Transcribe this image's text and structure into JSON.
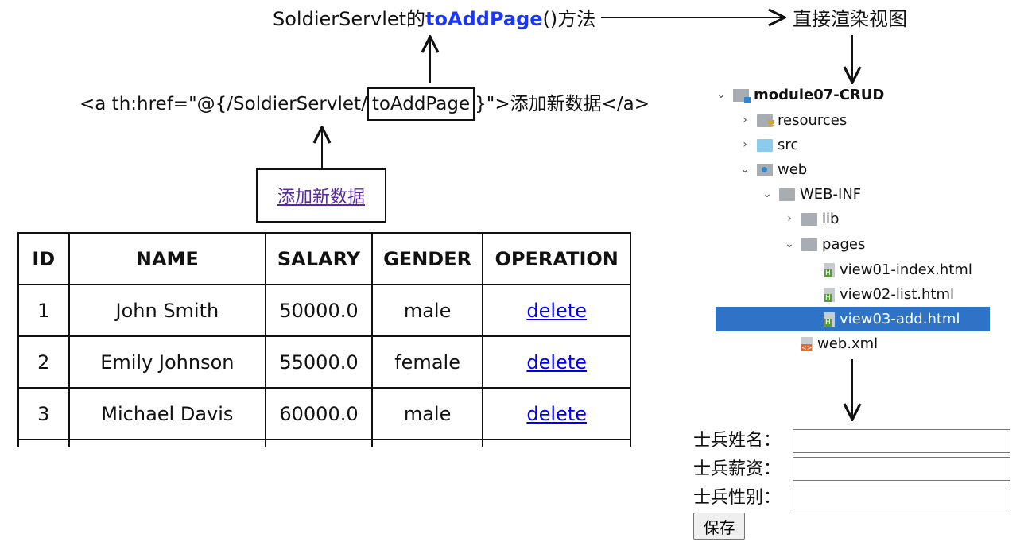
{
  "caption": {
    "method_prefix": "SoldierServlet的",
    "method_name": "toAddPage",
    "method_suffix": "()方法",
    "render_view": "直接渲染视图"
  },
  "anchor_code": {
    "before": "<a th:href=\"@{/SoldierServlet/",
    "boxed": "toAddPage",
    "after": "}\">添加新数据</a>"
  },
  "link": {
    "label": "添加新数据"
  },
  "table": {
    "headers": [
      "ID",
      "NAME",
      "SALARY",
      "GENDER",
      "OPERATION"
    ],
    "rows": [
      {
        "id": "1",
        "name": "John Smith",
        "salary": "50000.0",
        "gender": "male",
        "op": "delete"
      },
      {
        "id": "2",
        "name": "Emily Johnson",
        "salary": "55000.0",
        "gender": "female",
        "op": "delete"
      },
      {
        "id": "3",
        "name": "Michael Davis",
        "salary": "60000.0",
        "gender": "male",
        "op": "delete"
      }
    ]
  },
  "tree": {
    "items": [
      {
        "label": "module07-CRUD",
        "chevron": "expanded",
        "icon": "module-icon"
      },
      {
        "label": "resources",
        "chevron": "collapsed",
        "icon": "resources-folder-icon"
      },
      {
        "label": "src",
        "chevron": "collapsed",
        "icon": "source-folder-icon"
      },
      {
        "label": "web",
        "chevron": "expanded",
        "icon": "web-folder-icon"
      },
      {
        "label": "WEB-INF",
        "chevron": "expanded",
        "icon": "folder-icon"
      },
      {
        "label": "lib",
        "chevron": "collapsed",
        "icon": "folder-icon"
      },
      {
        "label": "pages",
        "chevron": "expanded",
        "icon": "folder-icon"
      },
      {
        "label": "view01-index.html",
        "chevron": "none",
        "icon": "html-file-icon"
      },
      {
        "label": "view02-list.html",
        "chevron": "none",
        "icon": "html-file-icon"
      },
      {
        "label": "view03-add.html",
        "chevron": "none",
        "icon": "html-file-icon",
        "selected": true
      },
      {
        "label": "web.xml",
        "chevron": "none",
        "icon": "xml-file-icon"
      }
    ]
  },
  "form": {
    "name_label": "士兵姓名：",
    "salary_label": "士兵薪资：",
    "gender_label": "士兵性别：",
    "save_label": "保存"
  },
  "colors": {
    "highlight": "#1a35ff",
    "selection": "#2f73c6",
    "link": "#0000ee",
    "visited_link": "#5a2aa0"
  }
}
